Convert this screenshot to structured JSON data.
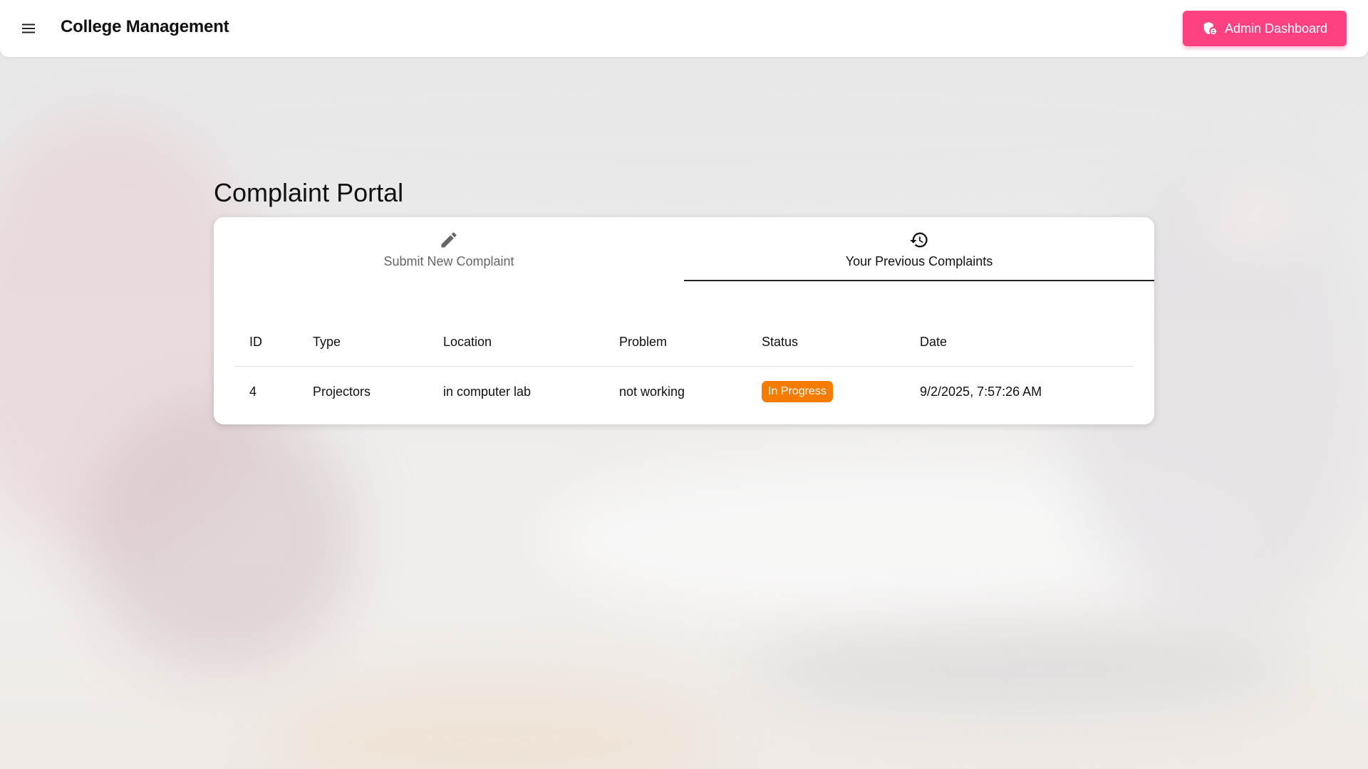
{
  "app": {
    "title": "College Management",
    "admin_button_label": "Admin Dashboard",
    "accent_color": "#ff4081"
  },
  "portal": {
    "title": "Complaint Portal",
    "tabs": [
      {
        "label": "Submit New Complaint",
        "icon": "pencil-icon",
        "active": false
      },
      {
        "label": "Your Previous Complaints",
        "icon": "history-icon",
        "active": true
      }
    ]
  },
  "complaints": {
    "columns": [
      "ID",
      "Type",
      "Location",
      "Problem",
      "Status",
      "Date"
    ],
    "rows": [
      {
        "id": "4",
        "type": "Projectors",
        "location": "in computer lab",
        "problem": "not working",
        "status": "In Progress",
        "status_color": "#f57c00",
        "date": "9/2/2025, 7:57:26 AM"
      }
    ]
  }
}
